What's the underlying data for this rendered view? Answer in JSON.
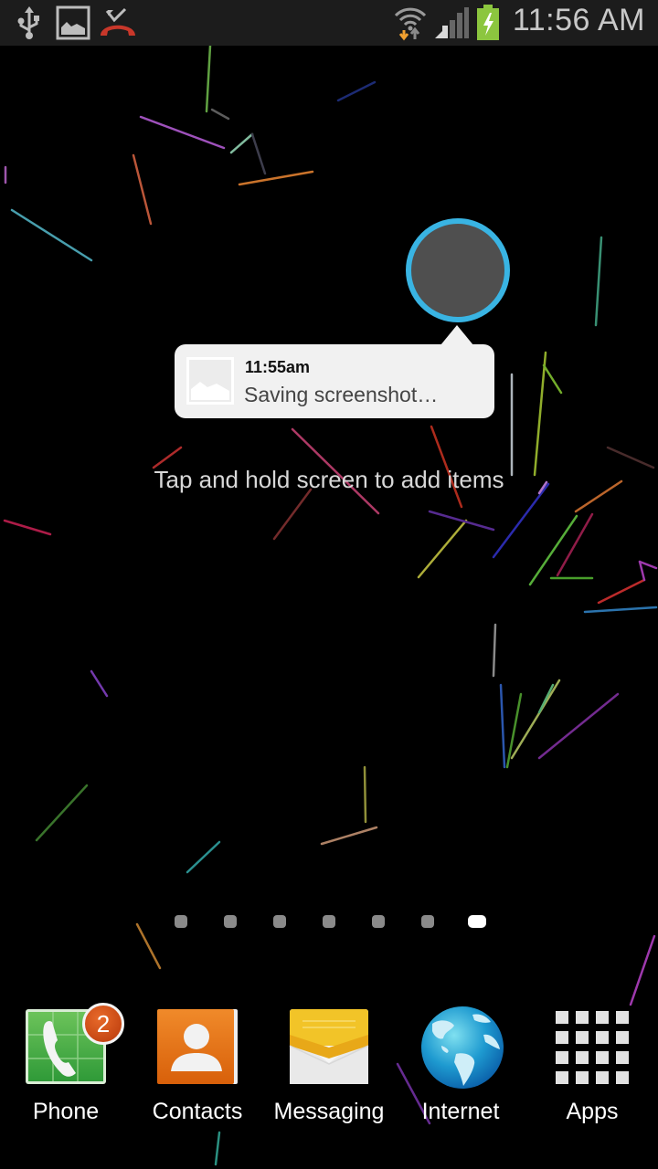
{
  "status_bar": {
    "time": "11:56 AM",
    "left_icons": [
      "usb-icon",
      "screenshot-image-icon",
      "missed-call-icon"
    ],
    "right_icons": [
      "wifi-icon",
      "signal-icon",
      "battery-charging-icon"
    ],
    "colors": {
      "missed_call": "#c8372a",
      "battery": "#8cc63f",
      "wifi_down_arrow": "#f0a030"
    }
  },
  "screenshot_toast": {
    "time": "11:55am",
    "message": "Saving screenshot…",
    "ring_color": "#39b4e3"
  },
  "home": {
    "hint": "Tap and hold screen to add items",
    "pages": {
      "count": 7,
      "current": 7
    }
  },
  "dock": {
    "items": [
      {
        "label": "Phone",
        "icon": "phone-icon",
        "badge": "2"
      },
      {
        "label": "Contacts",
        "icon": "contacts-icon"
      },
      {
        "label": "Messaging",
        "icon": "messaging-icon"
      },
      {
        "label": "Internet",
        "icon": "internet-globe-icon"
      },
      {
        "label": "Apps",
        "icon": "apps-grid-icon"
      }
    ]
  }
}
